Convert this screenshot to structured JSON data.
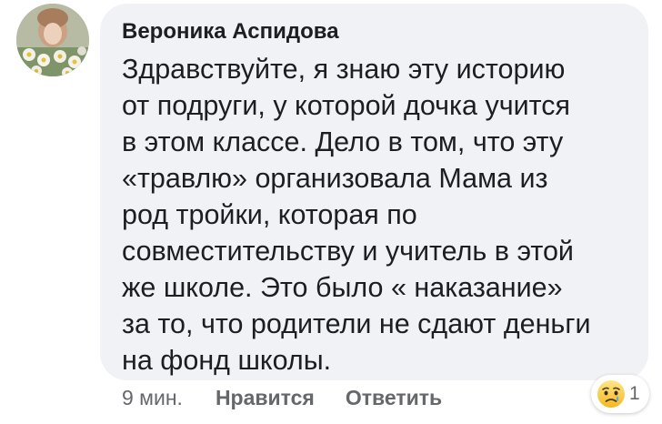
{
  "comment": {
    "author": "Вероника Аспидова",
    "text": "Здравствуйте, я знаю эту историю\nот подруги, у которой дочка учится\nв этом классе. Дело в том, что эту\n«травлю» организовала Мама из\nрод тройки, которая по\nсовместительству и учитель в этой\nже школе. Это было « наказание»\nза то, что родители не сдают деньги\nна фонд школы.",
    "bubble_color": "#f0f2f5"
  },
  "actions": {
    "time": "9 мин.",
    "like_label": "Нравится",
    "reply_label": "Ответить"
  },
  "reaction": {
    "icon": "sad-face-icon",
    "count": "1"
  }
}
